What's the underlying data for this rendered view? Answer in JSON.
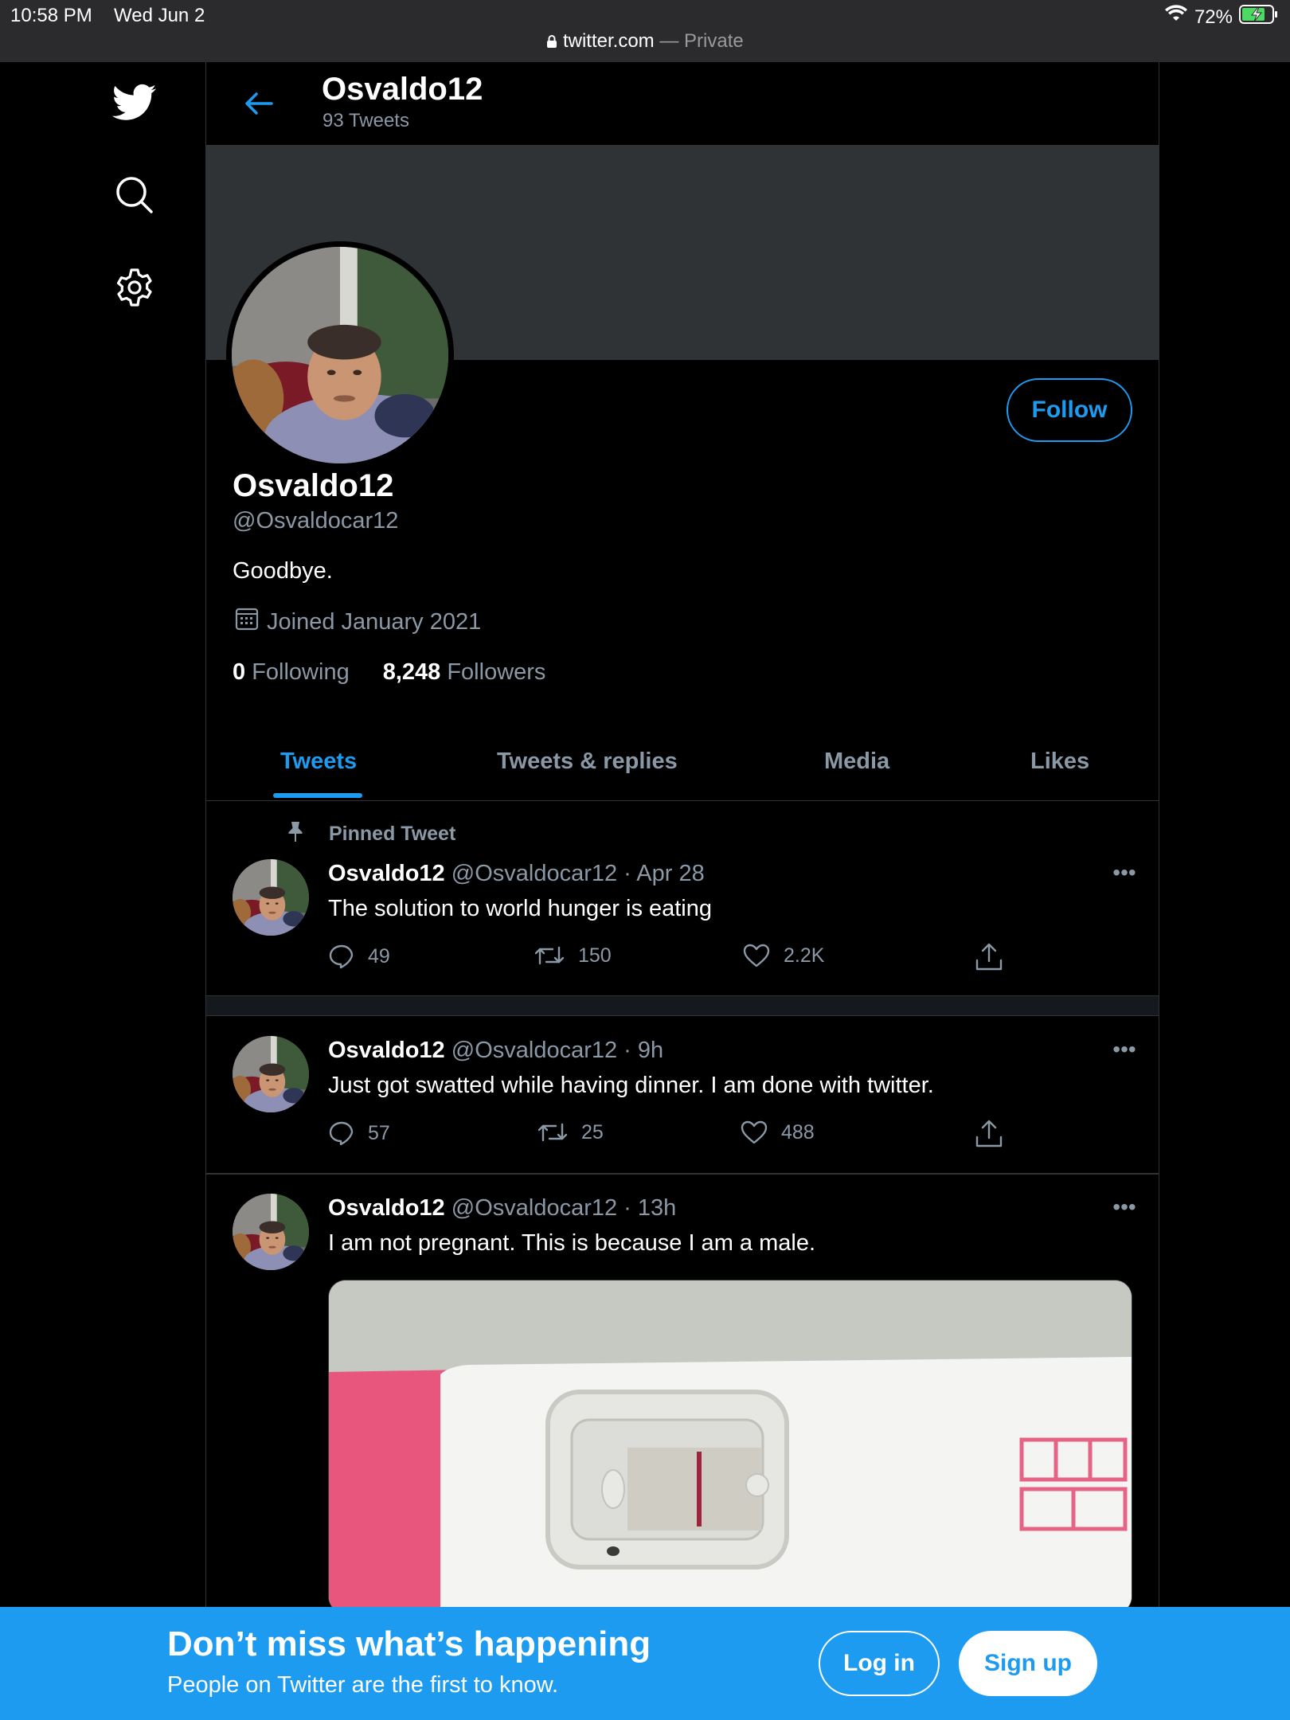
{
  "status_bar": {
    "time": "10:58 PM",
    "date": "Wed Jun 2",
    "battery": "72%",
    "url": "twitter.com",
    "url_suffix": " — Private"
  },
  "nav": {
    "icons": [
      "twitter-logo-icon",
      "search-icon",
      "gear-icon"
    ]
  },
  "header": {
    "name": "Osvaldo12",
    "tweet_count": "93 Tweets"
  },
  "profile": {
    "display_name": "Osvaldo12",
    "handle": "@Osvaldocar12",
    "bio": "Goodbye.",
    "joined": "Joined January 2021",
    "following_count": "0",
    "following_label": "Following",
    "followers_count": "8,248",
    "followers_label": "Followers",
    "follow_button": "Follow"
  },
  "tabs": [
    {
      "label": "Tweets",
      "active": true
    },
    {
      "label": "Tweets & replies",
      "active": false
    },
    {
      "label": "Media",
      "active": false
    },
    {
      "label": "Likes",
      "active": false
    }
  ],
  "tweets": [
    {
      "pinned_label": "Pinned Tweet",
      "name": "Osvaldo12",
      "meta": "@Osvaldocar12 · Apr 28",
      "text": "The solution to world hunger is eating",
      "replies": "49",
      "retweets": "150",
      "likes": "2.2K"
    },
    {
      "name": "Osvaldo12",
      "meta": "@Osvaldocar12 · 9h",
      "text": "Just got swatted while having dinner.  I am done with twitter.",
      "replies": "57",
      "retweets": "25",
      "likes": "488"
    },
    {
      "name": "Osvaldo12",
      "meta": "@Osvaldocar12 · 13h",
      "text": "I am not pregnant. This is because I am a male."
    }
  ],
  "cta": {
    "title": "Don’t miss what’s happening",
    "subtitle": "People on Twitter are the first to know.",
    "login": "Log in",
    "signup": "Sign up"
  },
  "colors": {
    "accent": "#1d9bf0",
    "background": "#000000",
    "secondary_text": "#8b98a5",
    "border": "#2f3336"
  }
}
